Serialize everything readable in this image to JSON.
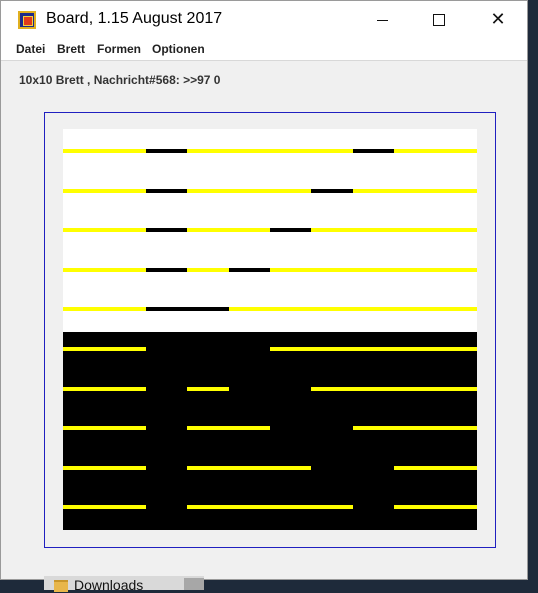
{
  "window": {
    "title": "Board, 1.15 August 2017",
    "controls": {
      "minimize": "minimize",
      "maximize": "maximize",
      "close": "✕"
    }
  },
  "menu": {
    "items": [
      "Datei",
      "Brett",
      "Formen",
      "Optionen"
    ]
  },
  "status_text": "10x10 Brett , Nachricht#568: >>97 0",
  "board": {
    "columns": 10,
    "rows": 10,
    "bar_color": "#ffff00",
    "light_background": "#ffffff",
    "dark_background": "#000000",
    "gap_color_on_light": "#000000",
    "dark_rows_start": 5,
    "gaps": [
      [
        2,
        7
      ],
      [
        2,
        6
      ],
      [
        2,
        5
      ],
      [
        2,
        4
      ],
      [
        2,
        3
      ],
      [
        2,
        3,
        4
      ],
      [
        2,
        4,
        5
      ],
      [
        2,
        5,
        6
      ],
      [
        2,
        6,
        7
      ],
      [
        2,
        7
      ]
    ]
  },
  "background_window": {
    "label": "Downloads"
  }
}
